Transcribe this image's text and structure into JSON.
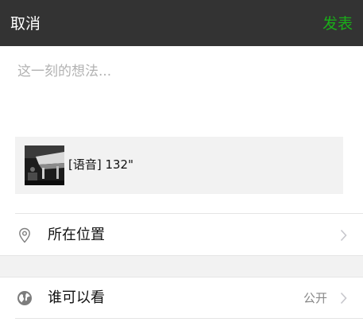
{
  "nav": {
    "cancel_label": "取消",
    "publish_label": "发表",
    "publish_color": "#1aad19",
    "background_color": "#333333"
  },
  "compose": {
    "placeholder": "这一刻的想法...",
    "value": ""
  },
  "attachment": {
    "type": "voice",
    "label": "[语音] 132\""
  },
  "options": {
    "location": {
      "icon": "location-pin-icon",
      "label": "所在位置",
      "chevron": "chevron-right-icon"
    },
    "visibility": {
      "icon": "globe-icon",
      "label": "谁可以看",
      "value": "公开",
      "chevron": "chevron-right-icon"
    }
  }
}
